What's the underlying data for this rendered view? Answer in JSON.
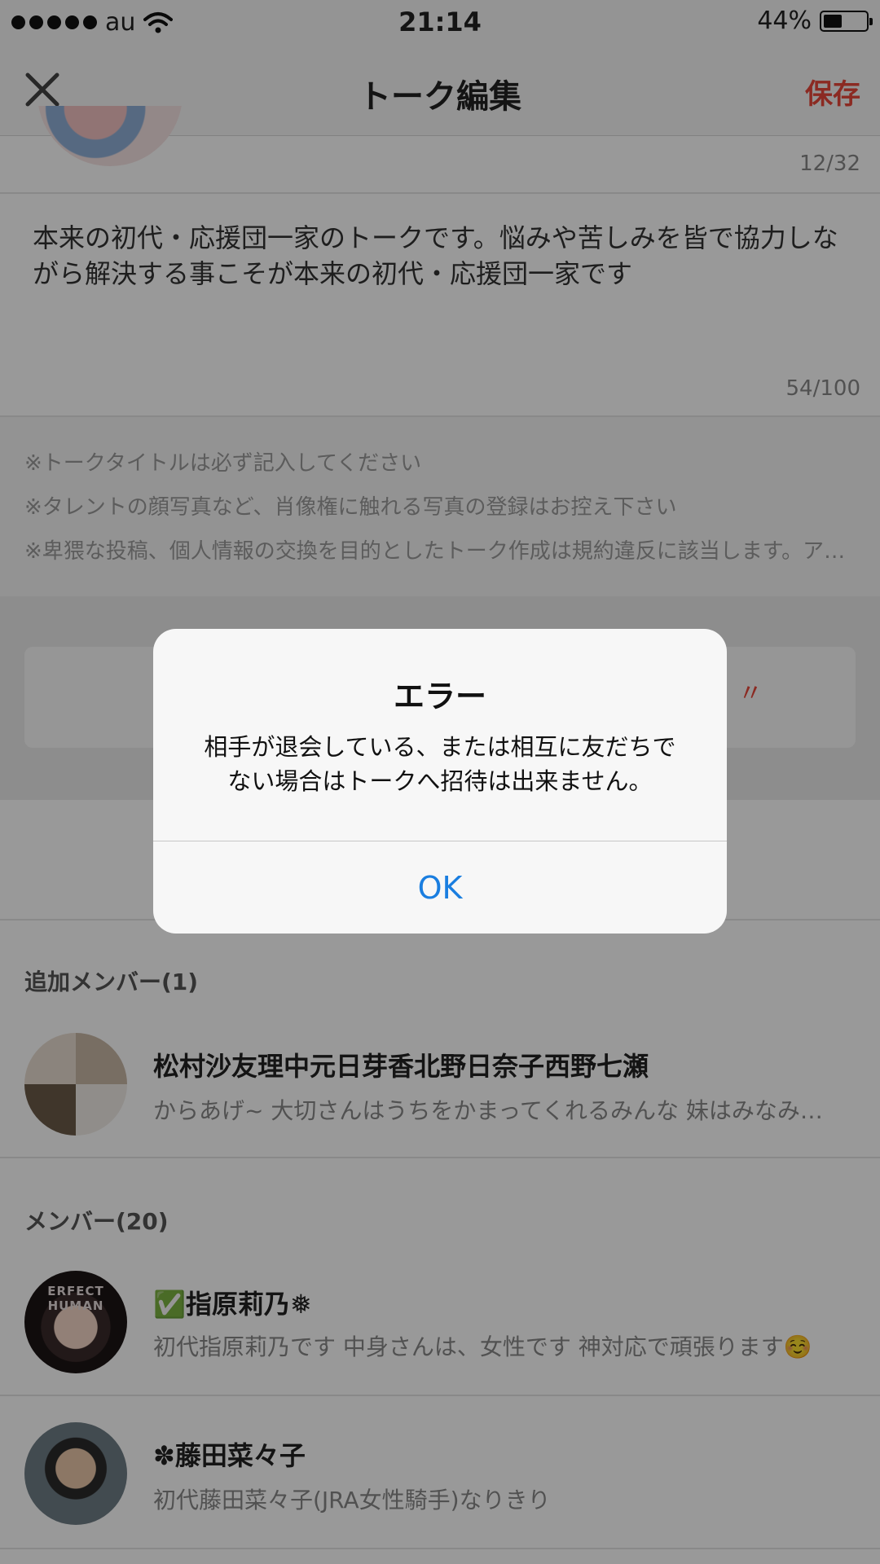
{
  "status_bar": {
    "carrier": "au",
    "time": "21:14",
    "battery_percent": "44%",
    "battery_level": 0.44
  },
  "nav": {
    "title": "トーク編集",
    "save_label": "保存"
  },
  "form": {
    "title_count": "12/32",
    "description": "本来の初代・応援団一家のトークです。悩みや苦しみを皆で協力しながら解決する事こそが本来の初代・応援団一家です",
    "description_count": "54/100",
    "notes": [
      "※トークタイトルは必ず記入してください",
      "※タレントの顔写真など、肖像権に触れる写真の登録はお控え下さい",
      "※卑猥な投稿、個人情報の交換を目的としたトーク作成は規約違反に該当します。ア…"
    ]
  },
  "added_members": {
    "header": "追加メンバー(1)",
    "items": [
      {
        "name": "松村沙友理中元日芽香北野日奈子西野七瀬",
        "desc": "からあげ~ 大切さんはうちをかまってくれるみんな 妹はみなみ…"
      }
    ]
  },
  "members": {
    "header": "メンバー(20)",
    "items": [
      {
        "name": "✅指原莉乃❅",
        "desc": "初代指原莉乃です 中身さんは、女性です 神対応で頑張ります☺️",
        "avatar_text": "ERFECT HUMAN"
      },
      {
        "name": "✽藤田菜々子",
        "desc": "初代藤田菜々子(JRA女性騎手)なりきり"
      }
    ]
  },
  "alert": {
    "title": "エラー",
    "message": "相手が退会している、または相互に友だちでない場合はトークへ招待は出来ません。",
    "ok_label": "OK"
  },
  "colors": {
    "accent": "#e8463a",
    "link_blue": "#1a7ee0",
    "overlay": "rgba(0,0,0,0.4)"
  }
}
